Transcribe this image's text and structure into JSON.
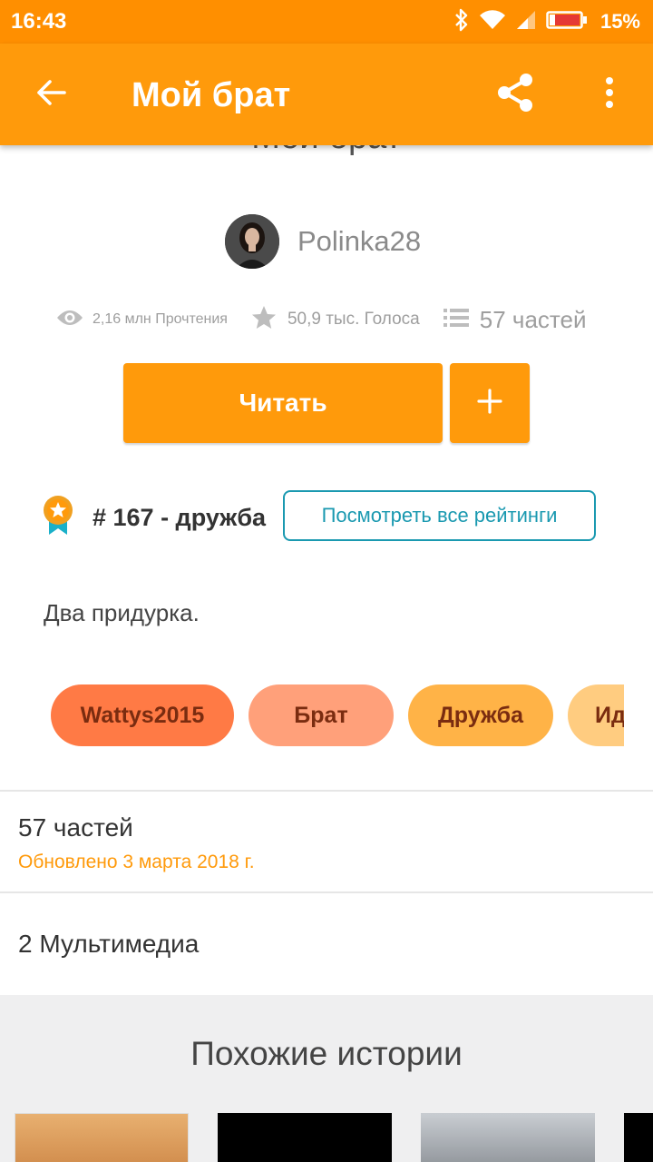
{
  "status": {
    "time": "16:43",
    "battery_pct": "15%",
    "battery_level": 0.15,
    "icons": [
      "bluetooth-icon",
      "wifi-icon",
      "signal-icon",
      "battery-icon"
    ]
  },
  "app_bar": {
    "title": "Мой брат",
    "icons": [
      "back-arrow-icon",
      "share-icon",
      "more-vert-icon"
    ],
    "background": "#ff9a0b"
  },
  "story": {
    "title": "Мой брат",
    "author": "Polinka28",
    "reads": "2,16 млн Прочтения",
    "votes": "50,9 тыс. Голоса",
    "parts": "57 частей",
    "read_button": "Читать",
    "add_button": "+",
    "ranking": "# 167 - дружба",
    "ratings_button": "Посмотреть все рейтинги",
    "description": "Два придурка.",
    "tags": [
      {
        "label": "Wattys2015",
        "color": "#ff7a45"
      },
      {
        "label": "Брат",
        "color": "#ffa07a"
      },
      {
        "label": "Дружба",
        "color": "#ffb347"
      },
      {
        "label": "Ид",
        "color": "#ffcc80"
      }
    ]
  },
  "toc": {
    "parts_label": "57 частей",
    "updated": "Обновлено 3 марта 2018 г.",
    "media_label": "2 Мультимедиа"
  },
  "similar": {
    "title": "Похожие истории"
  },
  "colors": {
    "accent": "#ff9a0b",
    "status_bar": "#ff8f00",
    "link": "#1a99b0"
  }
}
